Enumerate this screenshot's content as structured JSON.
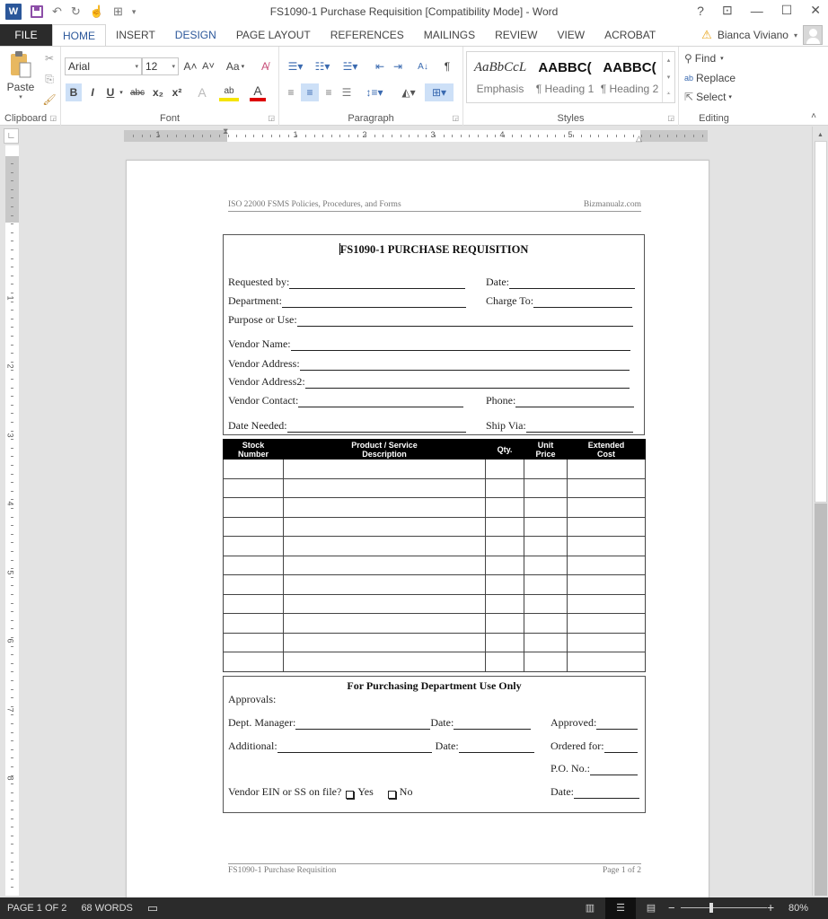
{
  "window": {
    "title": "FS1090-1 Purchase Requisition [Compatibility Mode] - Word",
    "controls": {
      "help": "?",
      "ribbon_display": "⊡",
      "minimize": "—",
      "maximize": "☐",
      "close": "✕"
    }
  },
  "quick_access": {
    "undo": "↶",
    "redo": "↻",
    "touch": "☝",
    "more": "⊞",
    "customize": "▾"
  },
  "tabs": [
    "FILE",
    "HOME",
    "INSERT",
    "DESIGN",
    "PAGE LAYOUT",
    "REFERENCES",
    "MAILINGS",
    "REVIEW",
    "VIEW",
    "ACROBAT"
  ],
  "active_tab": "HOME",
  "user": {
    "name": "Bianca Viviano",
    "warning": "⚠"
  },
  "ribbon": {
    "clipboard": {
      "label": "Clipboard",
      "paste": "Paste"
    },
    "font": {
      "label": "Font",
      "family": "Arial",
      "size": "12",
      "grow": "A˄",
      "shrink": "A˅",
      "case": "Aa",
      "bold": "B",
      "italic": "I",
      "underline": "U",
      "strike": "abc",
      "subscript": "x₂",
      "superscript": "x²",
      "effects": "A",
      "highlight": "ab",
      "color": "A"
    },
    "paragraph": {
      "label": "Paragraph",
      "sort": "A↓",
      "pilcrow": "¶"
    },
    "styles": {
      "label": "Styles",
      "items": [
        {
          "preview": "AaBbCcL",
          "name": "Emphasis"
        },
        {
          "preview": "AABBC(",
          "name": "¶ Heading 1"
        },
        {
          "preview": "AABBC(",
          "name": "¶ Heading 2"
        }
      ]
    },
    "editing": {
      "label": "Editing",
      "find": "Find",
      "replace": "Replace",
      "select": "Select"
    }
  },
  "ruler": {
    "numbers": [
      "1",
      "1",
      "2",
      "3",
      "4",
      "5"
    ],
    "vertical_numbers": [
      "1",
      "2",
      "3",
      "4",
      "5",
      "6",
      "7",
      "8"
    ]
  },
  "document": {
    "header_left": "ISO 22000 FSMS Policies, Procedures, and Forms",
    "header_right": "Bizmanualz.com",
    "form_title": "FS1090-1 PURCHASE REQUISITION",
    "fields": {
      "requested_by": "Requested by:",
      "date": "Date:",
      "department": "Department:",
      "charge_to": "Charge To:",
      "purpose": "Purpose or Use:",
      "vendor_name": "Vendor Name:",
      "vendor_address": "Vendor Address:",
      "vendor_address2": "Vendor Address2:",
      "vendor_contact": "Vendor Contact:",
      "phone": "Phone:",
      "date_needed": "Date Needed:",
      "ship_via": "Ship Via:"
    },
    "table": {
      "headers": [
        [
          "Stock",
          "Number"
        ],
        [
          "Product / Service",
          "Description"
        ],
        [
          "Qty.",
          ""
        ],
        [
          "Unit",
          "Price"
        ],
        [
          "Extended",
          "Cost"
        ]
      ],
      "empty_rows": 11
    },
    "purchasing": {
      "title": "For Purchasing Department Use Only",
      "approvals": "Approvals:",
      "dept_manager": "Dept. Manager:",
      "date1": "Date:",
      "approved": "Approved:",
      "additional": "Additional:",
      "date2": "Date:",
      "ordered_for": "Ordered for:",
      "po_no": "P.O. No.:",
      "vendor_ein": "Vendor EIN or SS on file?",
      "yes": "Yes",
      "no": "No",
      "date3": "Date:"
    },
    "footer_left": "FS1090-1 Purchase Requisition",
    "footer_right": "Page 1 of 2"
  },
  "status_bar": {
    "page": "PAGE 1 OF 2",
    "words": "68 WORDS",
    "zoom_minus": "−",
    "zoom_plus": "+",
    "zoom": "80%"
  }
}
